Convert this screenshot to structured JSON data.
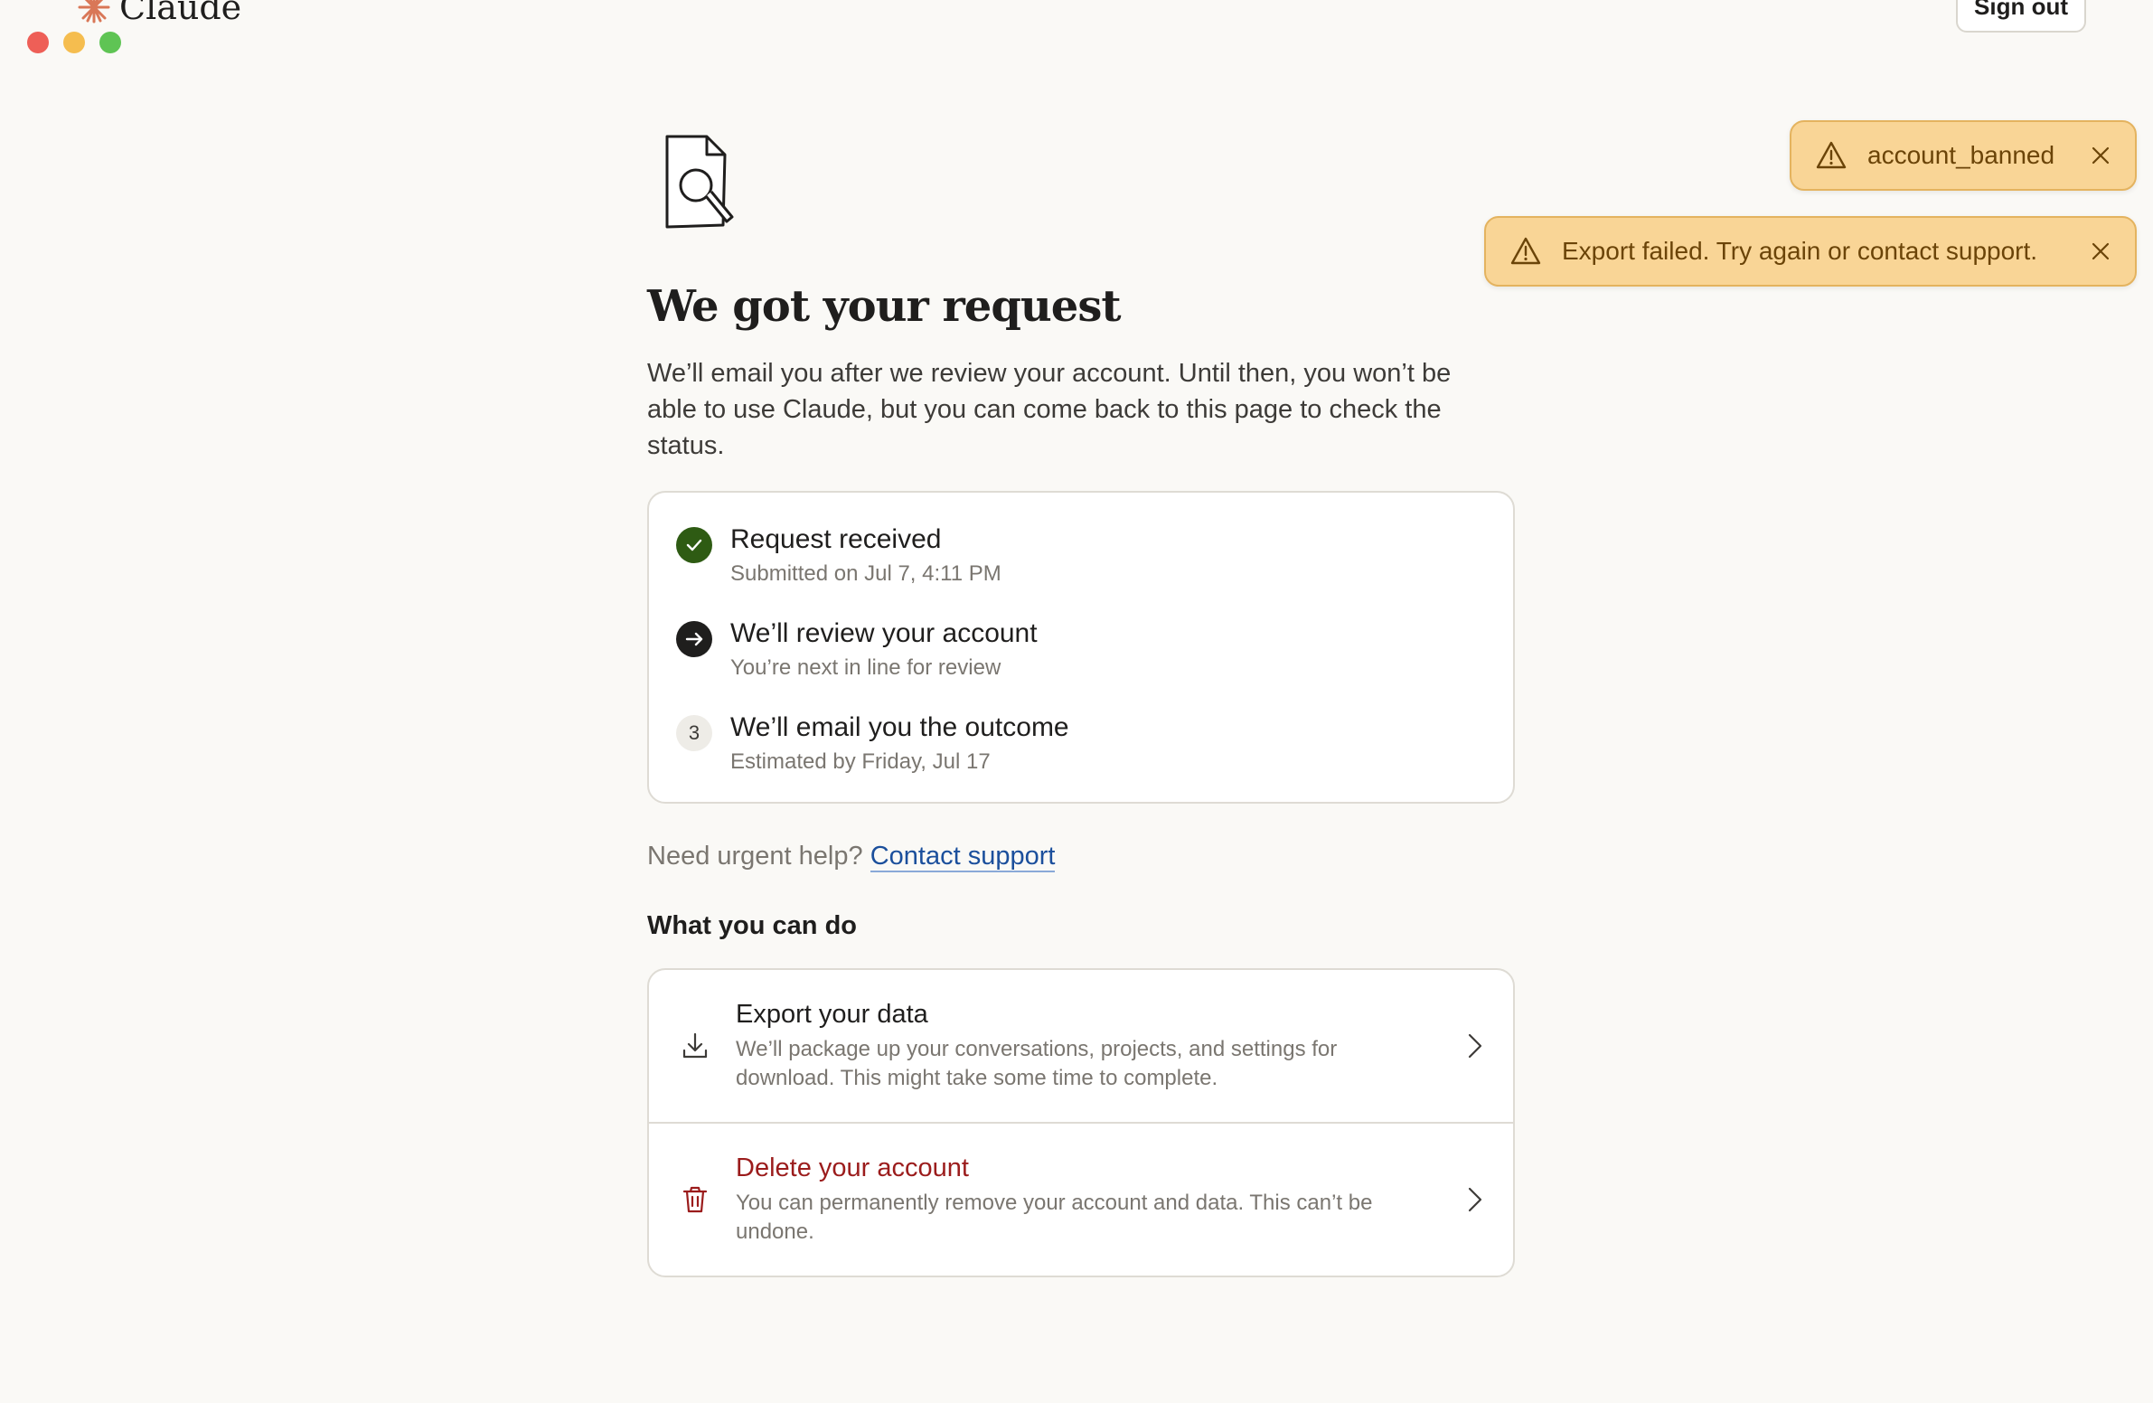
{
  "window": {
    "controls": [
      "close",
      "minimize",
      "maximize"
    ]
  },
  "header": {
    "brand": "Claude",
    "sign_out_label": "Sign out"
  },
  "toasts": [
    {
      "icon": "warning-icon",
      "message": "account_banned"
    },
    {
      "icon": "warning-icon",
      "message": "Export failed. Try again or contact support."
    }
  ],
  "main": {
    "title": "We got your request",
    "lead": "We’ll email you after we review your account. Until then, you won’t be able to use Claude, but you can come back to this page to check the status.",
    "steps": [
      {
        "state": "done",
        "title": "Request received",
        "subtitle": "Submitted on Jul 7, 4:11 PM"
      },
      {
        "state": "current",
        "title": "We’ll review your account",
        "subtitle": "You’re next in line for review"
      },
      {
        "state": "pending",
        "number": "3",
        "title": "We’ll email you the outcome",
        "subtitle": "Estimated by Friday, Jul 17"
      }
    ],
    "help_prefix": "Need urgent help?",
    "help_link": "Contact support",
    "section_title": "What you can do",
    "actions": [
      {
        "icon": "download-icon",
        "title": "Export your data",
        "description": "We’ll package up your conversations, projects, and settings for download. This might take some time to complete."
      },
      {
        "icon": "trash-icon",
        "title": "Delete your account",
        "description": "You can permanently remove your account and data. This can’t be undone."
      }
    ]
  },
  "colors": {
    "accent_danger": "#9b1c1c",
    "toast_bg": "#f9d596",
    "step_done": "#2e5b13",
    "link": "#1b4f9c"
  }
}
